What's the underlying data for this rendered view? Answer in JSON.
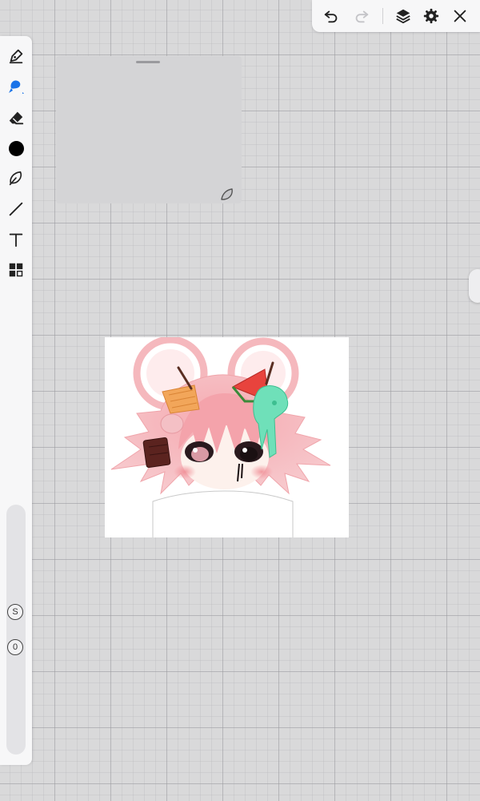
{
  "top_toolbar": {
    "icons": [
      "undo-icon",
      "redo-icon",
      "layers-icon",
      "settings-icon",
      "close-icon"
    ]
  },
  "left_toolbar": {
    "tools": [
      "pen-icon",
      "brush-icon",
      "eraser-icon",
      "color-swatch",
      "lasso-icon",
      "line-icon",
      "text-icon",
      "grid-tool-icon"
    ],
    "active_tool": "brush-icon",
    "active_color": "#000000",
    "brush_size_label": "S",
    "opacity_label": "0"
  },
  "colors": {
    "accent": "#1a73e8",
    "panel_bg": "#f7f7f8",
    "canvas_bg": "#d9d9da"
  }
}
